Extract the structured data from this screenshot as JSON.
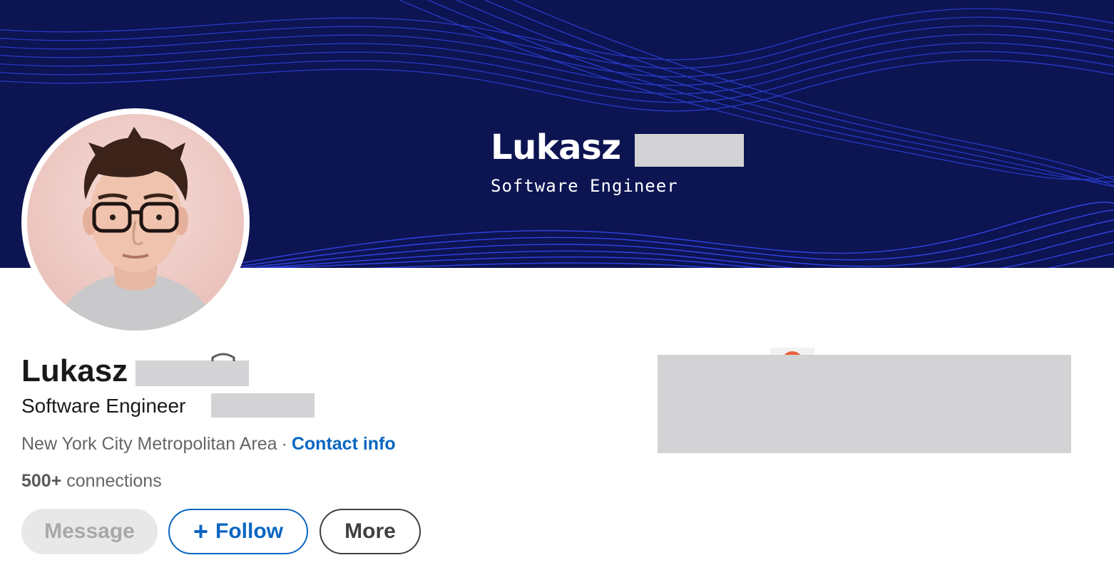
{
  "banner": {
    "name": "Lukasz",
    "title": "Software Engineer"
  },
  "profile": {
    "name": "Lukasz",
    "headline": "Software Engineer",
    "location": "New York City Metropolitan Area",
    "separator": "·",
    "contact_label": "Contact info",
    "connections_count": "500+",
    "connections_label": "connections"
  },
  "actions": {
    "message_label": "Message",
    "follow_plus": "+",
    "follow_label": "Follow",
    "more_label": "More"
  },
  "icons": {
    "name_badge": "shield-badge-icon",
    "follow_plus": "plus-icon"
  },
  "colors": {
    "banner_bg": "#0c1452",
    "wave": "#3a4bff",
    "link": "#0a66c2",
    "text_primary": "#191919",
    "text_secondary": "#666666",
    "redaction": "#d3d3d5"
  }
}
